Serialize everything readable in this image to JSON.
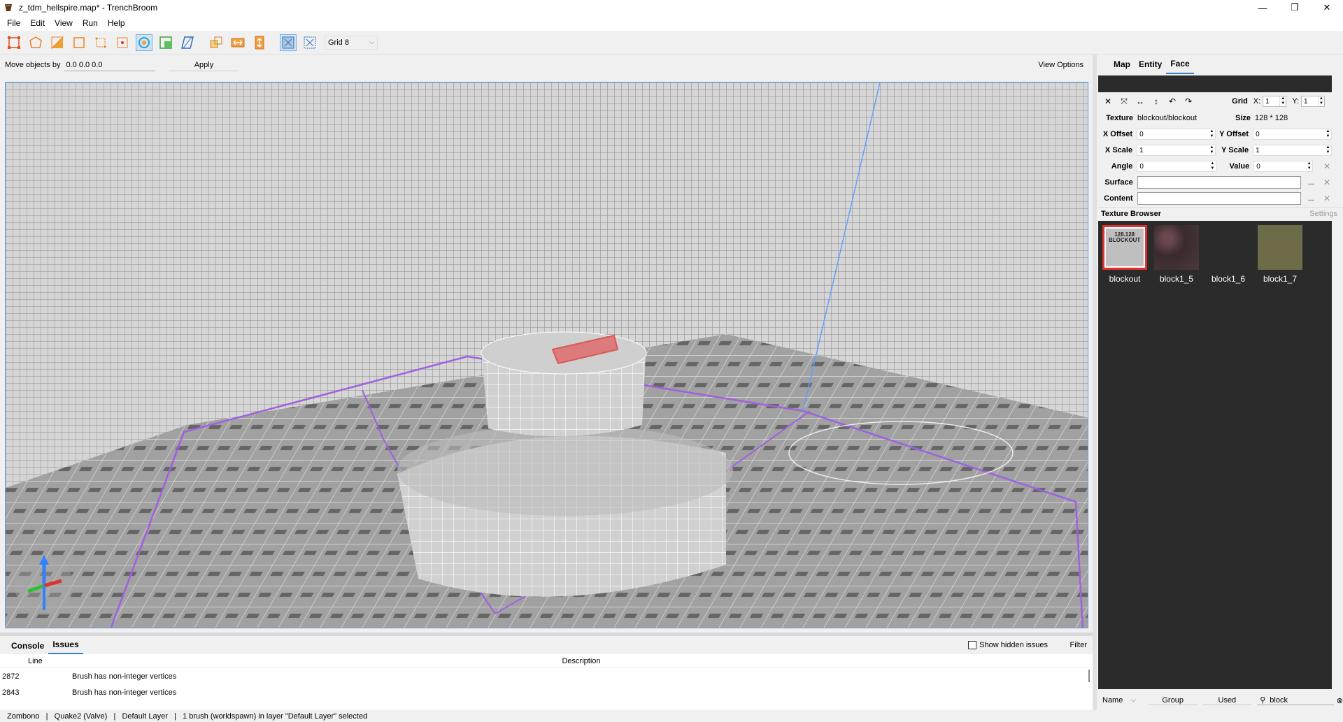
{
  "window": {
    "title": "z_tdm_hellspire.map* - TrenchBroom",
    "minimize": "—",
    "maximize": "❐",
    "close": "✕"
  },
  "menu": [
    "File",
    "Edit",
    "View",
    "Run",
    "Help"
  ],
  "toolbar": {
    "grid_label": "Grid 8"
  },
  "move_bar": {
    "label": "Move objects by",
    "value": "0.0 0.0 0.0",
    "apply": "Apply",
    "view_options": "View Options"
  },
  "inspector": {
    "tabs": [
      "Map",
      "Entity",
      "Face"
    ],
    "active_tab": "Face",
    "grid_label": "Grid",
    "grid_x_label": "X:",
    "grid_x": "1",
    "grid_y_label": "Y:",
    "grid_y": "1",
    "texture_label": "Texture",
    "texture_value": "blockout/blockout",
    "size_label": "Size",
    "size_value": "128 * 128",
    "x_offset_label": "X Offset",
    "x_offset": "0",
    "y_offset_label": "Y Offset",
    "y_offset": "0",
    "x_scale_label": "X Scale",
    "x_scale": "1",
    "y_scale_label": "Y Scale",
    "y_scale": "1",
    "angle_label": "Angle",
    "angle": "0",
    "value_label": "Value",
    "value": "0",
    "surface_label": "Surface",
    "content_label": "Content",
    "dots": "..."
  },
  "texture_browser": {
    "title": "Texture Browser",
    "settings": "Settings",
    "textures": [
      {
        "name": "blockout",
        "thumb_text": "128.128\nBLOCKOUT",
        "color": "#bfbfbf",
        "selected": true
      },
      {
        "name": "block1_5",
        "color": "#4a3a3e"
      },
      {
        "name": "block1_6",
        "color": "#2b2b2b"
      },
      {
        "name": "block1_7",
        "color": "#6e6c48"
      }
    ],
    "sort_label": "Name",
    "group_label": "Group",
    "used_label": "Used",
    "search_value": "block"
  },
  "bottom": {
    "tabs": [
      "Console",
      "Issues"
    ],
    "active_tab": "Issues",
    "show_hidden": "Show hidden issues",
    "filter": "Filter",
    "col_line": "Line",
    "col_desc": "Description",
    "issues": [
      {
        "line": "2872",
        "desc": "Brush has non-integer vertices"
      },
      {
        "line": "2843",
        "desc": "Brush has non-integer vertices"
      }
    ]
  },
  "status": "Zombono   |   Quake2 (Valve)   |   Default Layer   |   1 brush (worldspawn) in layer \"Default Layer\" selected",
  "colors": {
    "accent": "#3a7ec8",
    "selection": "#e03030",
    "grid_bg": "#2b2b2b"
  }
}
